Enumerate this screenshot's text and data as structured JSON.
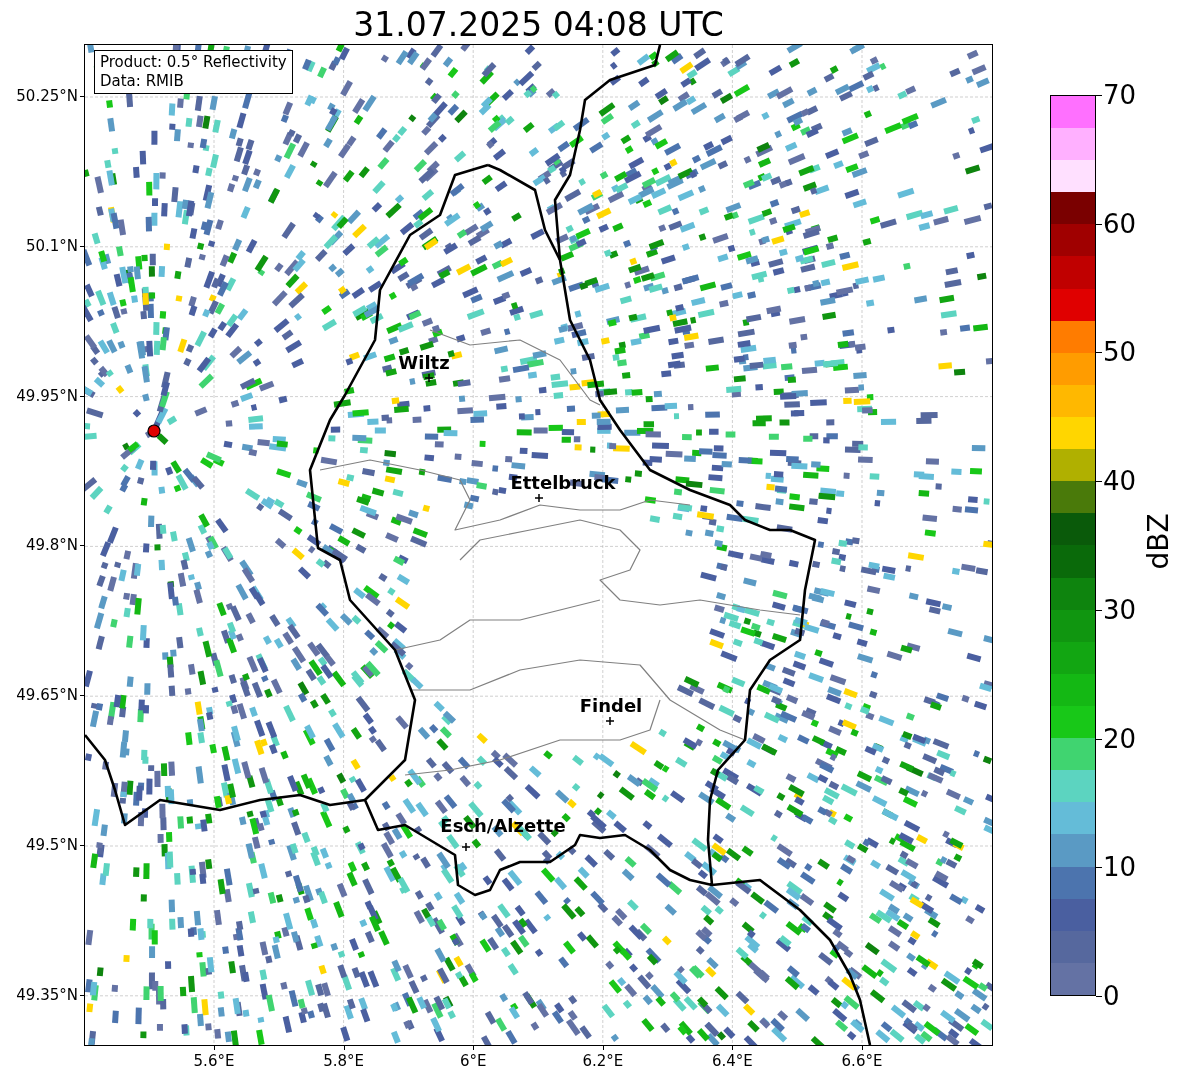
{
  "title": "31.07.2025 04:08 UTC",
  "info_box": [
    "Product: 0.5° Reflectivity",
    "Data: RMIB"
  ],
  "y_ticks": [
    "50.25°N",
    "50.1°N",
    "49.95°N",
    "49.8°N",
    "49.65°N",
    "49.5°N",
    "49.35°N"
  ],
  "x_ticks": [
    "5.6°E",
    "5.8°E",
    "6°E",
    "6.2°E",
    "6.4°E",
    "6.6°E"
  ],
  "cities": [
    {
      "name": "Wiltz"
    },
    {
      "name": "Ettelbruck"
    },
    {
      "name": "Findel"
    },
    {
      "name": "Esch/Alzette"
    }
  ],
  "colorbar": {
    "label": "dBZ",
    "ticks": [
      "70",
      "60",
      "50",
      "40",
      "30",
      "20",
      "10",
      "0"
    ]
  }
}
